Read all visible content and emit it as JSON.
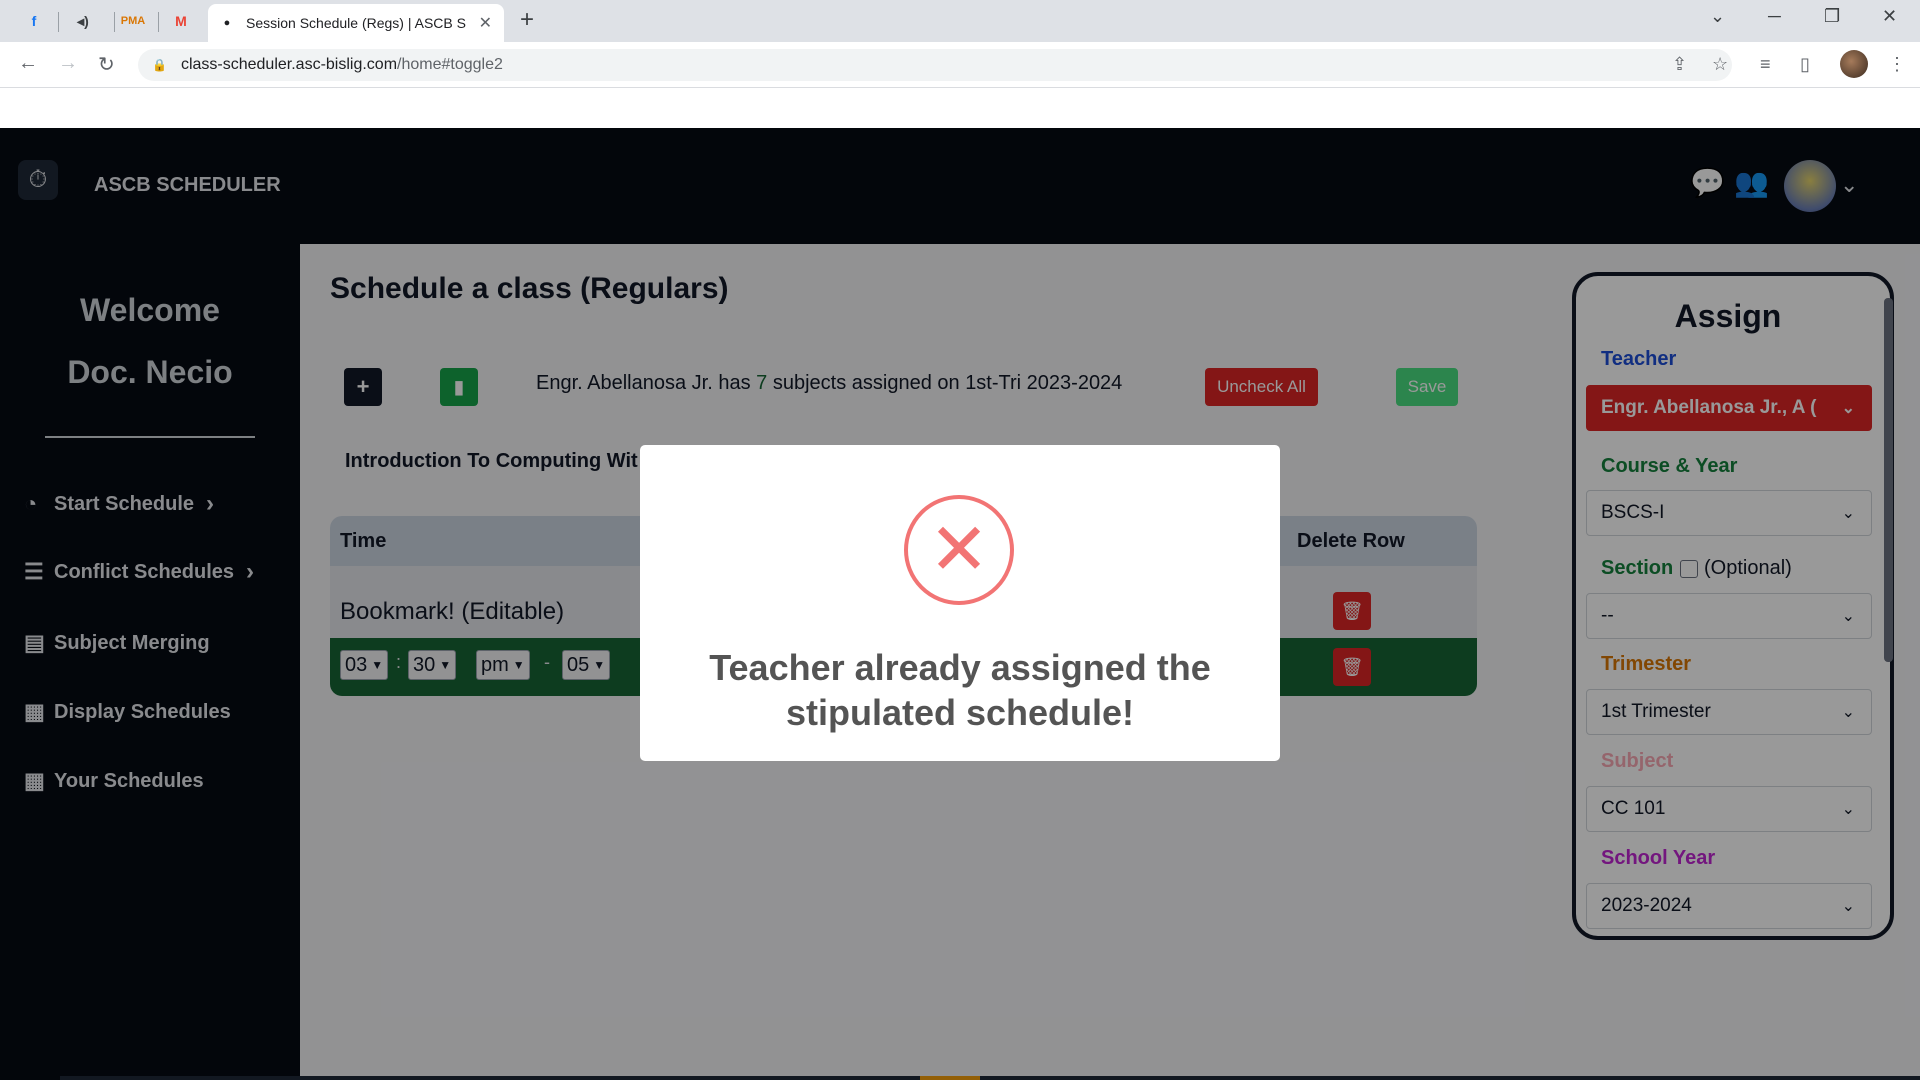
{
  "browser": {
    "tab_title": "Session Schedule (Regs) | ASCB S",
    "pinned_tabs": [
      "facebook-icon",
      "mute-icon",
      "pma-icon",
      "gmail-icon"
    ],
    "url_domain": "class-scheduler.asc-bislig.com",
    "url_path": "/home#toggle2"
  },
  "app": {
    "name": "ASCB SCHEDULER"
  },
  "sidebar": {
    "welcome": "Welcome",
    "user": "Doc. Necio",
    "items": [
      {
        "label": "Start Schedule",
        "icon": "pie-chart-icon",
        "chevron": true
      },
      {
        "label": "Conflict Schedules",
        "icon": "list-check-icon",
        "chevron": true
      },
      {
        "label": "Subject Merging",
        "icon": "newspaper-icon",
        "chevron": false
      },
      {
        "label": "Display Schedules",
        "icon": "calendar-icon",
        "chevron": false
      },
      {
        "label": "Your Schedules",
        "icon": "calendar-icon",
        "chevron": false
      }
    ]
  },
  "main": {
    "title": "Schedule a class (Regulars)",
    "info_prefix": "Engr. Abellanosa Jr. has",
    "info_count": "7",
    "info_suffix": "subjects assigned on 1st-Tri 2023-2024",
    "uncheck_all": "Uncheck All",
    "save": "Save",
    "subject_heading": "Introduction To Computing Wit",
    "table": {
      "col_time": "Time",
      "col_delete": "Delete Row",
      "bookmark_row": "Bookmark! (Editable)",
      "start_hour": "03",
      "start_minute": "30",
      "start_ampm": "pm",
      "end_hour": "05"
    }
  },
  "assign": {
    "title": "Assign",
    "teacher_label": "Teacher",
    "teacher_value": "Engr. Abellanosa Jr., A (",
    "course_label": "Course & Year",
    "course_value": "BSCS-I",
    "section_label": "Section",
    "section_optional": "(Optional)",
    "section_value": "--",
    "trimester_label": "Trimester",
    "trimester_value": "1st Trimester",
    "subject_label": "Subject",
    "subject_value": "CC 101",
    "year_label": "School Year",
    "year_value": "2023-2024",
    "colors": {
      "teacher": "#1d4ed8",
      "course": "#15803d",
      "section": "#15803d",
      "trimester": "#d97706",
      "subject": "#f9a8b4",
      "year": "#c026d3"
    }
  },
  "modal": {
    "message": "Teacher already assigned the stipulated schedule!"
  }
}
